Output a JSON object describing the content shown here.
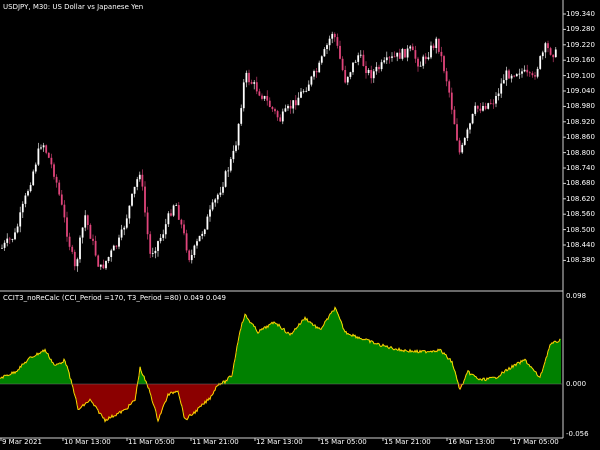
{
  "main_chart": {
    "title": "USDJPY, M30:  US Dollar vs Japanese Yen",
    "price_labels": [
      "109.340",
      "109.280",
      "109.220",
      "109.160",
      "109.100",
      "109.040",
      "108.980",
      "108.920",
      "108.860",
      "108.800",
      "108.740",
      "108.680",
      "108.620",
      "108.560",
      "108.500",
      "108.440",
      "108.380"
    ],
    "bull_color": "#ffffff",
    "bear_color": "#e0457b"
  },
  "indicator": {
    "title": "CCIT3_noReCalc (CCI_Period =170, T3_Period =80) 0.049 0.049",
    "scale_labels": [
      "0.098",
      "0.000",
      "-0.056"
    ],
    "positive_color": "#008000",
    "negative_color": "#8b0000",
    "line_color": "#ffd700"
  },
  "time_axis": {
    "labels": [
      "9 Mar 2021",
      "10 Mar 13:00",
      "11 Mar 05:00",
      "11 Mar 21:00",
      "12 Mar 13:00",
      "15 Mar 05:00",
      "15 Mar 21:00",
      "16 Mar 13:00",
      "17 Mar 05:00"
    ]
  }
}
